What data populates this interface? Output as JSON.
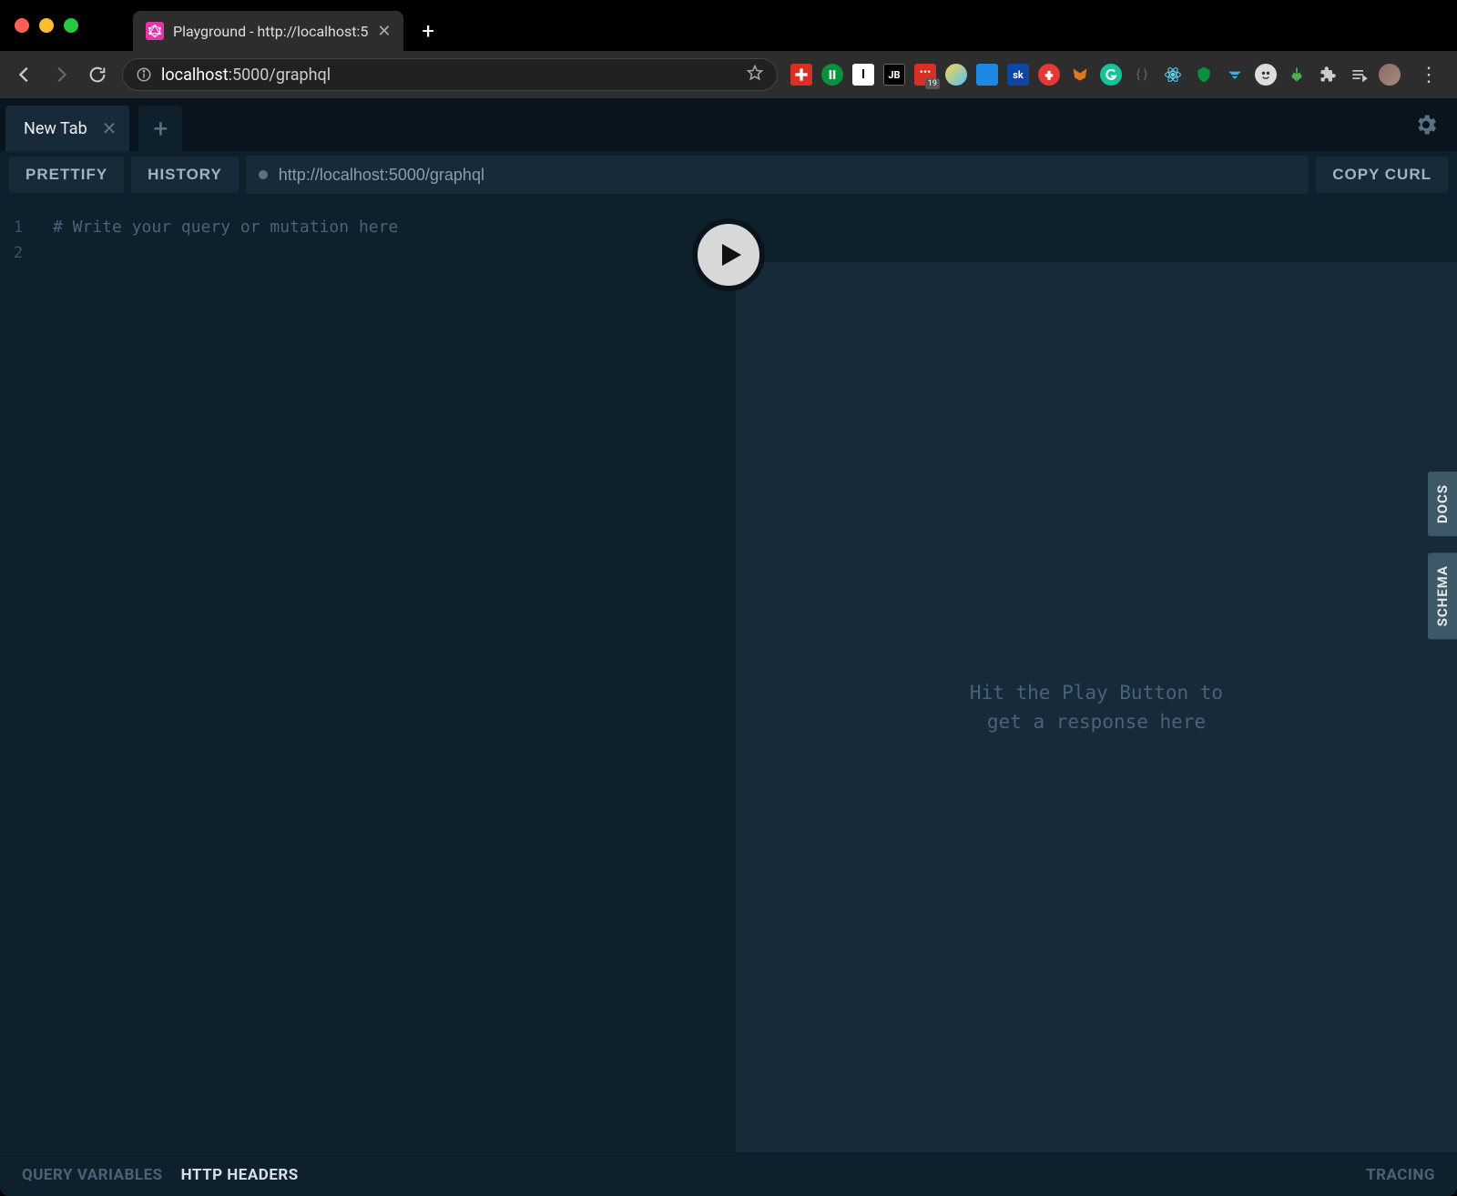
{
  "browser": {
    "tab_title": "Playground - http://localhost:5",
    "url_host": "localhost",
    "url_port_path": ":5000/graphql"
  },
  "extension_badge": "19",
  "playground": {
    "tab": {
      "label": "New Tab"
    },
    "actions": {
      "prettify": "PRETTIFY",
      "history": "HISTORY",
      "copy_curl": "COPY CURL"
    },
    "endpoint_value": "http://localhost:5000/graphql",
    "editor": {
      "line_numbers": [
        "1",
        "2"
      ],
      "comment": "# Write your query or mutation here"
    },
    "response_placeholder_line1": "Hit the Play Button to",
    "response_placeholder_line2": "get a response here",
    "side_tabs": {
      "docs": "DOCS",
      "schema": "SCHEMA"
    },
    "bottom": {
      "query_variables": "QUERY VARIABLES",
      "http_headers": "HTTP HEADERS",
      "tracing": "TRACING"
    }
  }
}
